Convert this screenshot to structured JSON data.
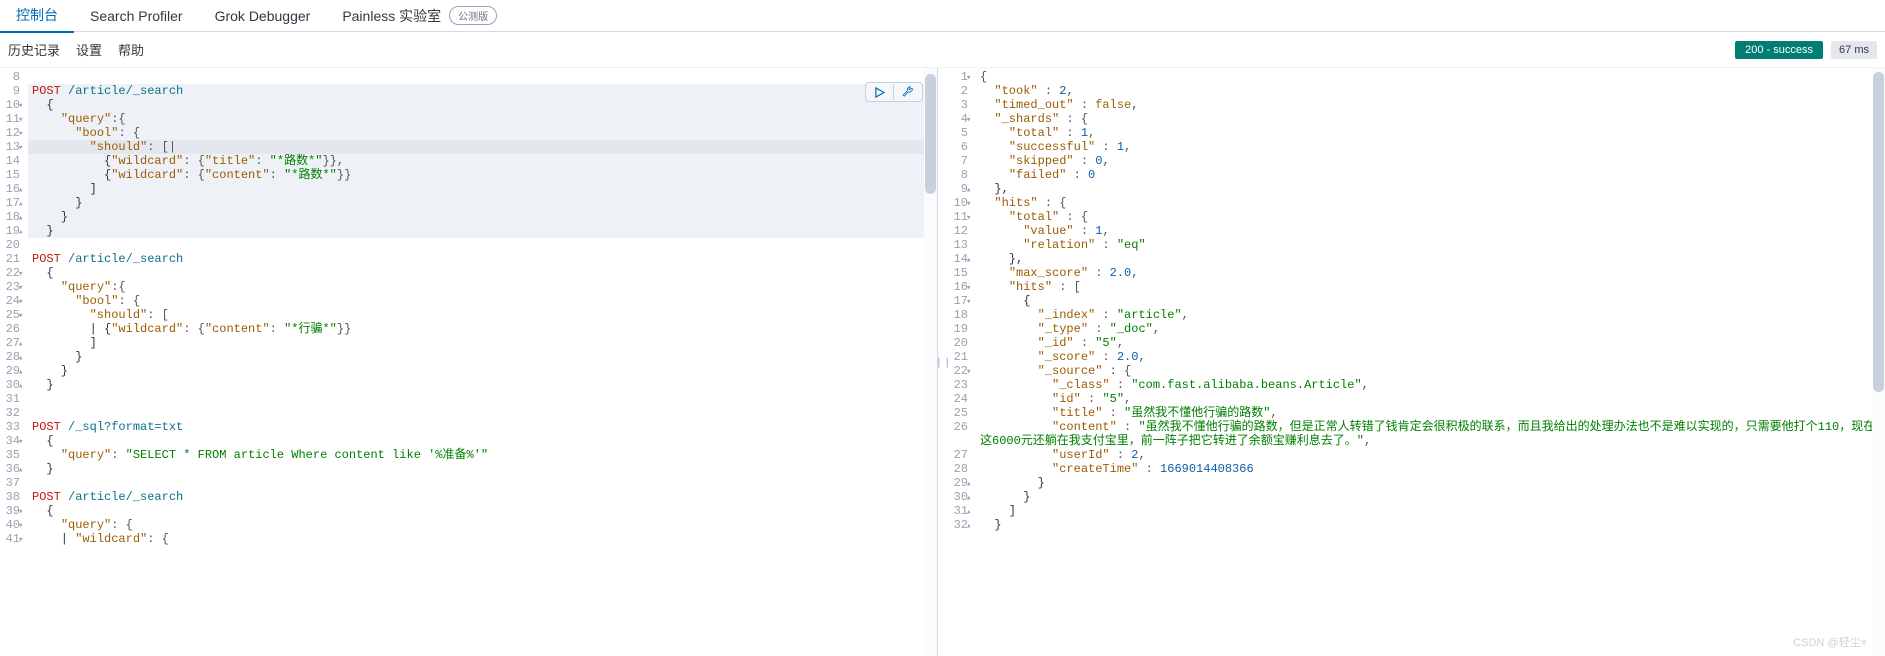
{
  "tabs": {
    "console": "控制台",
    "profiler": "Search Profiler",
    "grok": "Grok Debugger",
    "painless": "Painless 实验室",
    "betaBadge": "公测版"
  },
  "toolbar": {
    "history": "历史记录",
    "settings": "设置",
    "help": "帮助",
    "status": "200 - success",
    "time": "67 ms"
  },
  "request": {
    "startLine": 8,
    "lines": [
      {
        "n": 8,
        "fold": "",
        "seg": []
      },
      {
        "n": 9,
        "fold": "",
        "hl": true,
        "seg": [
          [
            "method",
            "POST"
          ],
          [
            "plain",
            " "
          ],
          [
            "path",
            "/article/_search"
          ]
        ]
      },
      {
        "n": 10,
        "fold": "▾",
        "hl": true,
        "seg": [
          [
            "plain",
            "  {"
          ]
        ]
      },
      {
        "n": 11,
        "fold": "▾",
        "hl": true,
        "seg": [
          [
            "plain",
            "    "
          ],
          [
            "key",
            "\"query\""
          ],
          [
            "punc",
            ":{"
          ]
        ]
      },
      {
        "n": 12,
        "fold": "▾",
        "hl": true,
        "seg": [
          [
            "plain",
            "      "
          ],
          [
            "key",
            "\"bool\""
          ],
          [
            "punc",
            ": {"
          ]
        ]
      },
      {
        "n": 13,
        "fold": "▾",
        "hl": true,
        "cursor": true,
        "seg": [
          [
            "plain",
            "        "
          ],
          [
            "key",
            "\"should\""
          ],
          [
            "punc",
            ": [|"
          ]
        ]
      },
      {
        "n": 14,
        "fold": "",
        "hl": true,
        "seg": [
          [
            "plain",
            "          {"
          ],
          [
            "key",
            "\"wildcard\""
          ],
          [
            "punc",
            ": {"
          ],
          [
            "key",
            "\"title\""
          ],
          [
            "punc",
            ": "
          ],
          [
            "str",
            "\"*路数*\""
          ],
          [
            "punc",
            "}},"
          ]
        ]
      },
      {
        "n": 15,
        "fold": "",
        "hl": true,
        "seg": [
          [
            "plain",
            "          {"
          ],
          [
            "key",
            "\"wildcard\""
          ],
          [
            "punc",
            ": {"
          ],
          [
            "key",
            "\"content\""
          ],
          [
            "punc",
            ": "
          ],
          [
            "str",
            "\"*路数*\""
          ],
          [
            "punc",
            "}}"
          ]
        ]
      },
      {
        "n": 16,
        "fold": "◂",
        "hl": true,
        "seg": [
          [
            "plain",
            "        ]"
          ]
        ]
      },
      {
        "n": 17,
        "fold": "◂",
        "hl": true,
        "seg": [
          [
            "plain",
            "      }"
          ]
        ]
      },
      {
        "n": 18,
        "fold": "◂",
        "hl": true,
        "seg": [
          [
            "plain",
            "    }"
          ]
        ]
      },
      {
        "n": 19,
        "fold": "◂",
        "hl": true,
        "seg": [
          [
            "plain",
            "  }"
          ]
        ]
      },
      {
        "n": 20,
        "fold": "",
        "seg": []
      },
      {
        "n": 21,
        "fold": "",
        "seg": [
          [
            "method",
            "POST"
          ],
          [
            "plain",
            " "
          ],
          [
            "path",
            "/article/_search"
          ]
        ]
      },
      {
        "n": 22,
        "fold": "▾",
        "seg": [
          [
            "plain",
            "  {"
          ]
        ]
      },
      {
        "n": 23,
        "fold": "▾",
        "seg": [
          [
            "plain",
            "    "
          ],
          [
            "key",
            "\"query\""
          ],
          [
            "punc",
            ":{"
          ]
        ]
      },
      {
        "n": 24,
        "fold": "▾",
        "seg": [
          [
            "plain",
            "      "
          ],
          [
            "key",
            "\"bool\""
          ],
          [
            "punc",
            ": {"
          ]
        ]
      },
      {
        "n": 25,
        "fold": "▾",
        "seg": [
          [
            "plain",
            "        "
          ],
          [
            "key",
            "\"should\""
          ],
          [
            "punc",
            ": ["
          ]
        ]
      },
      {
        "n": 26,
        "fold": "",
        "seg": [
          [
            "plain",
            "        | {"
          ],
          [
            "key",
            "\"wildcard\""
          ],
          [
            "punc",
            ": {"
          ],
          [
            "key",
            "\"content\""
          ],
          [
            "punc",
            ": "
          ],
          [
            "str",
            "\"*行骗*\""
          ],
          [
            "punc",
            "}}"
          ]
        ]
      },
      {
        "n": 27,
        "fold": "◂",
        "seg": [
          [
            "plain",
            "        ]"
          ]
        ]
      },
      {
        "n": 28,
        "fold": "◂",
        "seg": [
          [
            "plain",
            "      }"
          ]
        ]
      },
      {
        "n": 29,
        "fold": "◂",
        "seg": [
          [
            "plain",
            "    }"
          ]
        ]
      },
      {
        "n": 30,
        "fold": "◂",
        "seg": [
          [
            "plain",
            "  }"
          ]
        ]
      },
      {
        "n": 31,
        "fold": "",
        "seg": []
      },
      {
        "n": 32,
        "fold": "",
        "seg": []
      },
      {
        "n": 33,
        "fold": "",
        "seg": [
          [
            "method",
            "POST"
          ],
          [
            "plain",
            " "
          ],
          [
            "path",
            "/_sql?format=txt"
          ]
        ]
      },
      {
        "n": 34,
        "fold": "▾",
        "seg": [
          [
            "plain",
            "  {"
          ]
        ]
      },
      {
        "n": 35,
        "fold": "",
        "seg": [
          [
            "plain",
            "    "
          ],
          [
            "key",
            "\"query\""
          ],
          [
            "punc",
            ": "
          ],
          [
            "str",
            "\"SELECT * FROM article Where content like '%准备%'\""
          ]
        ]
      },
      {
        "n": 36,
        "fold": "◂",
        "seg": [
          [
            "plain",
            "  }"
          ]
        ]
      },
      {
        "n": 37,
        "fold": "",
        "seg": []
      },
      {
        "n": 38,
        "fold": "",
        "seg": [
          [
            "method",
            "POST"
          ],
          [
            "plain",
            " "
          ],
          [
            "path",
            "/article/_search"
          ]
        ]
      },
      {
        "n": 39,
        "fold": "▾",
        "seg": [
          [
            "plain",
            "  {"
          ]
        ]
      },
      {
        "n": 40,
        "fold": "▾",
        "seg": [
          [
            "plain",
            "    "
          ],
          [
            "key",
            "\"query\""
          ],
          [
            "punc",
            ": {"
          ]
        ]
      },
      {
        "n": 41,
        "fold": "▾",
        "seg": [
          [
            "plain",
            "    | "
          ],
          [
            "key",
            "\"wildcard\""
          ],
          [
            "punc",
            ": {"
          ]
        ]
      }
    ]
  },
  "response": {
    "lines": [
      {
        "n": 1,
        "fold": "▾",
        "seg": [
          [
            "punc",
            "{"
          ]
        ]
      },
      {
        "n": 2,
        "fold": "",
        "seg": [
          [
            "plain",
            "  "
          ],
          [
            "key",
            "\"took\""
          ],
          [
            "punc",
            " : "
          ],
          [
            "num",
            "2"
          ],
          [
            "punc",
            ","
          ]
        ]
      },
      {
        "n": 3,
        "fold": "",
        "seg": [
          [
            "plain",
            "  "
          ],
          [
            "key",
            "\"timed_out\""
          ],
          [
            "punc",
            " : "
          ],
          [
            "kw",
            "false"
          ],
          [
            "punc",
            ","
          ]
        ]
      },
      {
        "n": 4,
        "fold": "▾",
        "seg": [
          [
            "plain",
            "  "
          ],
          [
            "key",
            "\"_shards\""
          ],
          [
            "punc",
            " : {"
          ]
        ]
      },
      {
        "n": 5,
        "fold": "",
        "seg": [
          [
            "plain",
            "    "
          ],
          [
            "key",
            "\"total\""
          ],
          [
            "punc",
            " : "
          ],
          [
            "num",
            "1"
          ],
          [
            "punc",
            ","
          ]
        ]
      },
      {
        "n": 6,
        "fold": "",
        "seg": [
          [
            "plain",
            "    "
          ],
          [
            "key",
            "\"successful\""
          ],
          [
            "punc",
            " : "
          ],
          [
            "num",
            "1"
          ],
          [
            "punc",
            ","
          ]
        ]
      },
      {
        "n": 7,
        "fold": "",
        "seg": [
          [
            "plain",
            "    "
          ],
          [
            "key",
            "\"skipped\""
          ],
          [
            "punc",
            " : "
          ],
          [
            "num",
            "0"
          ],
          [
            "punc",
            ","
          ]
        ]
      },
      {
        "n": 8,
        "fold": "",
        "seg": [
          [
            "plain",
            "    "
          ],
          [
            "key",
            "\"failed\""
          ],
          [
            "punc",
            " : "
          ],
          [
            "num",
            "0"
          ]
        ]
      },
      {
        "n": 9,
        "fold": "◂",
        "seg": [
          [
            "plain",
            "  },"
          ]
        ]
      },
      {
        "n": 10,
        "fold": "▾",
        "seg": [
          [
            "plain",
            "  "
          ],
          [
            "key",
            "\"hits\""
          ],
          [
            "punc",
            " : {"
          ]
        ]
      },
      {
        "n": 11,
        "fold": "▾",
        "seg": [
          [
            "plain",
            "    "
          ],
          [
            "key",
            "\"total\""
          ],
          [
            "punc",
            " : {"
          ]
        ]
      },
      {
        "n": 12,
        "fold": "",
        "seg": [
          [
            "plain",
            "      "
          ],
          [
            "key",
            "\"value\""
          ],
          [
            "punc",
            " : "
          ],
          [
            "num",
            "1"
          ],
          [
            "punc",
            ","
          ]
        ]
      },
      {
        "n": 13,
        "fold": "",
        "seg": [
          [
            "plain",
            "      "
          ],
          [
            "key",
            "\"relation\""
          ],
          [
            "punc",
            " : "
          ],
          [
            "str",
            "\"eq\""
          ]
        ]
      },
      {
        "n": 14,
        "fold": "◂",
        "seg": [
          [
            "plain",
            "    },"
          ]
        ]
      },
      {
        "n": 15,
        "fold": "",
        "seg": [
          [
            "plain",
            "    "
          ],
          [
            "key",
            "\"max_score\""
          ],
          [
            "punc",
            " : "
          ],
          [
            "num",
            "2.0"
          ],
          [
            "punc",
            ","
          ]
        ]
      },
      {
        "n": 16,
        "fold": "▾",
        "seg": [
          [
            "plain",
            "    "
          ],
          [
            "key",
            "\"hits\""
          ],
          [
            "punc",
            " : ["
          ]
        ]
      },
      {
        "n": 17,
        "fold": "▾",
        "seg": [
          [
            "plain",
            "      {"
          ]
        ]
      },
      {
        "n": 18,
        "fold": "",
        "seg": [
          [
            "plain",
            "        "
          ],
          [
            "key",
            "\"_index\""
          ],
          [
            "punc",
            " : "
          ],
          [
            "str",
            "\"article\""
          ],
          [
            "punc",
            ","
          ]
        ]
      },
      {
        "n": 19,
        "fold": "",
        "seg": [
          [
            "plain",
            "        "
          ],
          [
            "key",
            "\"_type\""
          ],
          [
            "punc",
            " : "
          ],
          [
            "str",
            "\"_doc\""
          ],
          [
            "punc",
            ","
          ]
        ]
      },
      {
        "n": 20,
        "fold": "",
        "seg": [
          [
            "plain",
            "        "
          ],
          [
            "key",
            "\"_id\""
          ],
          [
            "punc",
            " : "
          ],
          [
            "str",
            "\"5\""
          ],
          [
            "punc",
            ","
          ]
        ]
      },
      {
        "n": 21,
        "fold": "",
        "seg": [
          [
            "plain",
            "        "
          ],
          [
            "key",
            "\"_score\""
          ],
          [
            "punc",
            " : "
          ],
          [
            "num",
            "2.0"
          ],
          [
            "punc",
            ","
          ]
        ]
      },
      {
        "n": 22,
        "fold": "▾",
        "seg": [
          [
            "plain",
            "        "
          ],
          [
            "key",
            "\"_source\""
          ],
          [
            "punc",
            " : {"
          ]
        ]
      },
      {
        "n": 23,
        "fold": "",
        "seg": [
          [
            "plain",
            "          "
          ],
          [
            "key",
            "\"_class\""
          ],
          [
            "punc",
            " : "
          ],
          [
            "str",
            "\"com.fast.alibaba.beans.Article\""
          ],
          [
            "punc",
            ","
          ]
        ]
      },
      {
        "n": 24,
        "fold": "",
        "seg": [
          [
            "plain",
            "          "
          ],
          [
            "key",
            "\"id\""
          ],
          [
            "punc",
            " : "
          ],
          [
            "str",
            "\"5\""
          ],
          [
            "punc",
            ","
          ]
        ]
      },
      {
        "n": 25,
        "fold": "",
        "seg": [
          [
            "plain",
            "          "
          ],
          [
            "key",
            "\"title\""
          ],
          [
            "punc",
            " : "
          ],
          [
            "str",
            "\"虽然我不懂他行骗的路数\""
          ],
          [
            "punc",
            ","
          ]
        ]
      },
      {
        "n": 26,
        "fold": "",
        "wrap": true,
        "seg": [
          [
            "plain",
            "          "
          ],
          [
            "key",
            "\"content\""
          ],
          [
            "punc",
            " : "
          ],
          [
            "str",
            "\"虽然我不懂他行骗的路数，但是正常人转错了钱肯定会很积极的联系，而且我给出的处理办法也不是难以实现的，只需要他打个110，现在这6000元还躺在我支付宝里，前一阵子把它转进了余额宝赚利息去了。\""
          ],
          [
            "punc",
            ","
          ]
        ]
      },
      {
        "n": 27,
        "fold": "",
        "seg": [
          [
            "plain",
            "          "
          ],
          [
            "key",
            "\"userId\""
          ],
          [
            "punc",
            " : "
          ],
          [
            "num",
            "2"
          ],
          [
            "punc",
            ","
          ]
        ]
      },
      {
        "n": 28,
        "fold": "",
        "seg": [
          [
            "plain",
            "          "
          ],
          [
            "key",
            "\"createTime\""
          ],
          [
            "punc",
            " : "
          ],
          [
            "num",
            "1669014408366"
          ]
        ]
      },
      {
        "n": 29,
        "fold": "◂",
        "seg": [
          [
            "plain",
            "        }"
          ]
        ]
      },
      {
        "n": 30,
        "fold": "◂",
        "seg": [
          [
            "plain",
            "      }"
          ]
        ]
      },
      {
        "n": 31,
        "fold": "◂",
        "seg": [
          [
            "plain",
            "    ]"
          ]
        ]
      },
      {
        "n": 32,
        "fold": "◂",
        "seg": [
          [
            "plain",
            "  }"
          ]
        ]
      }
    ]
  },
  "watermark": "CSDN @轻尘×"
}
